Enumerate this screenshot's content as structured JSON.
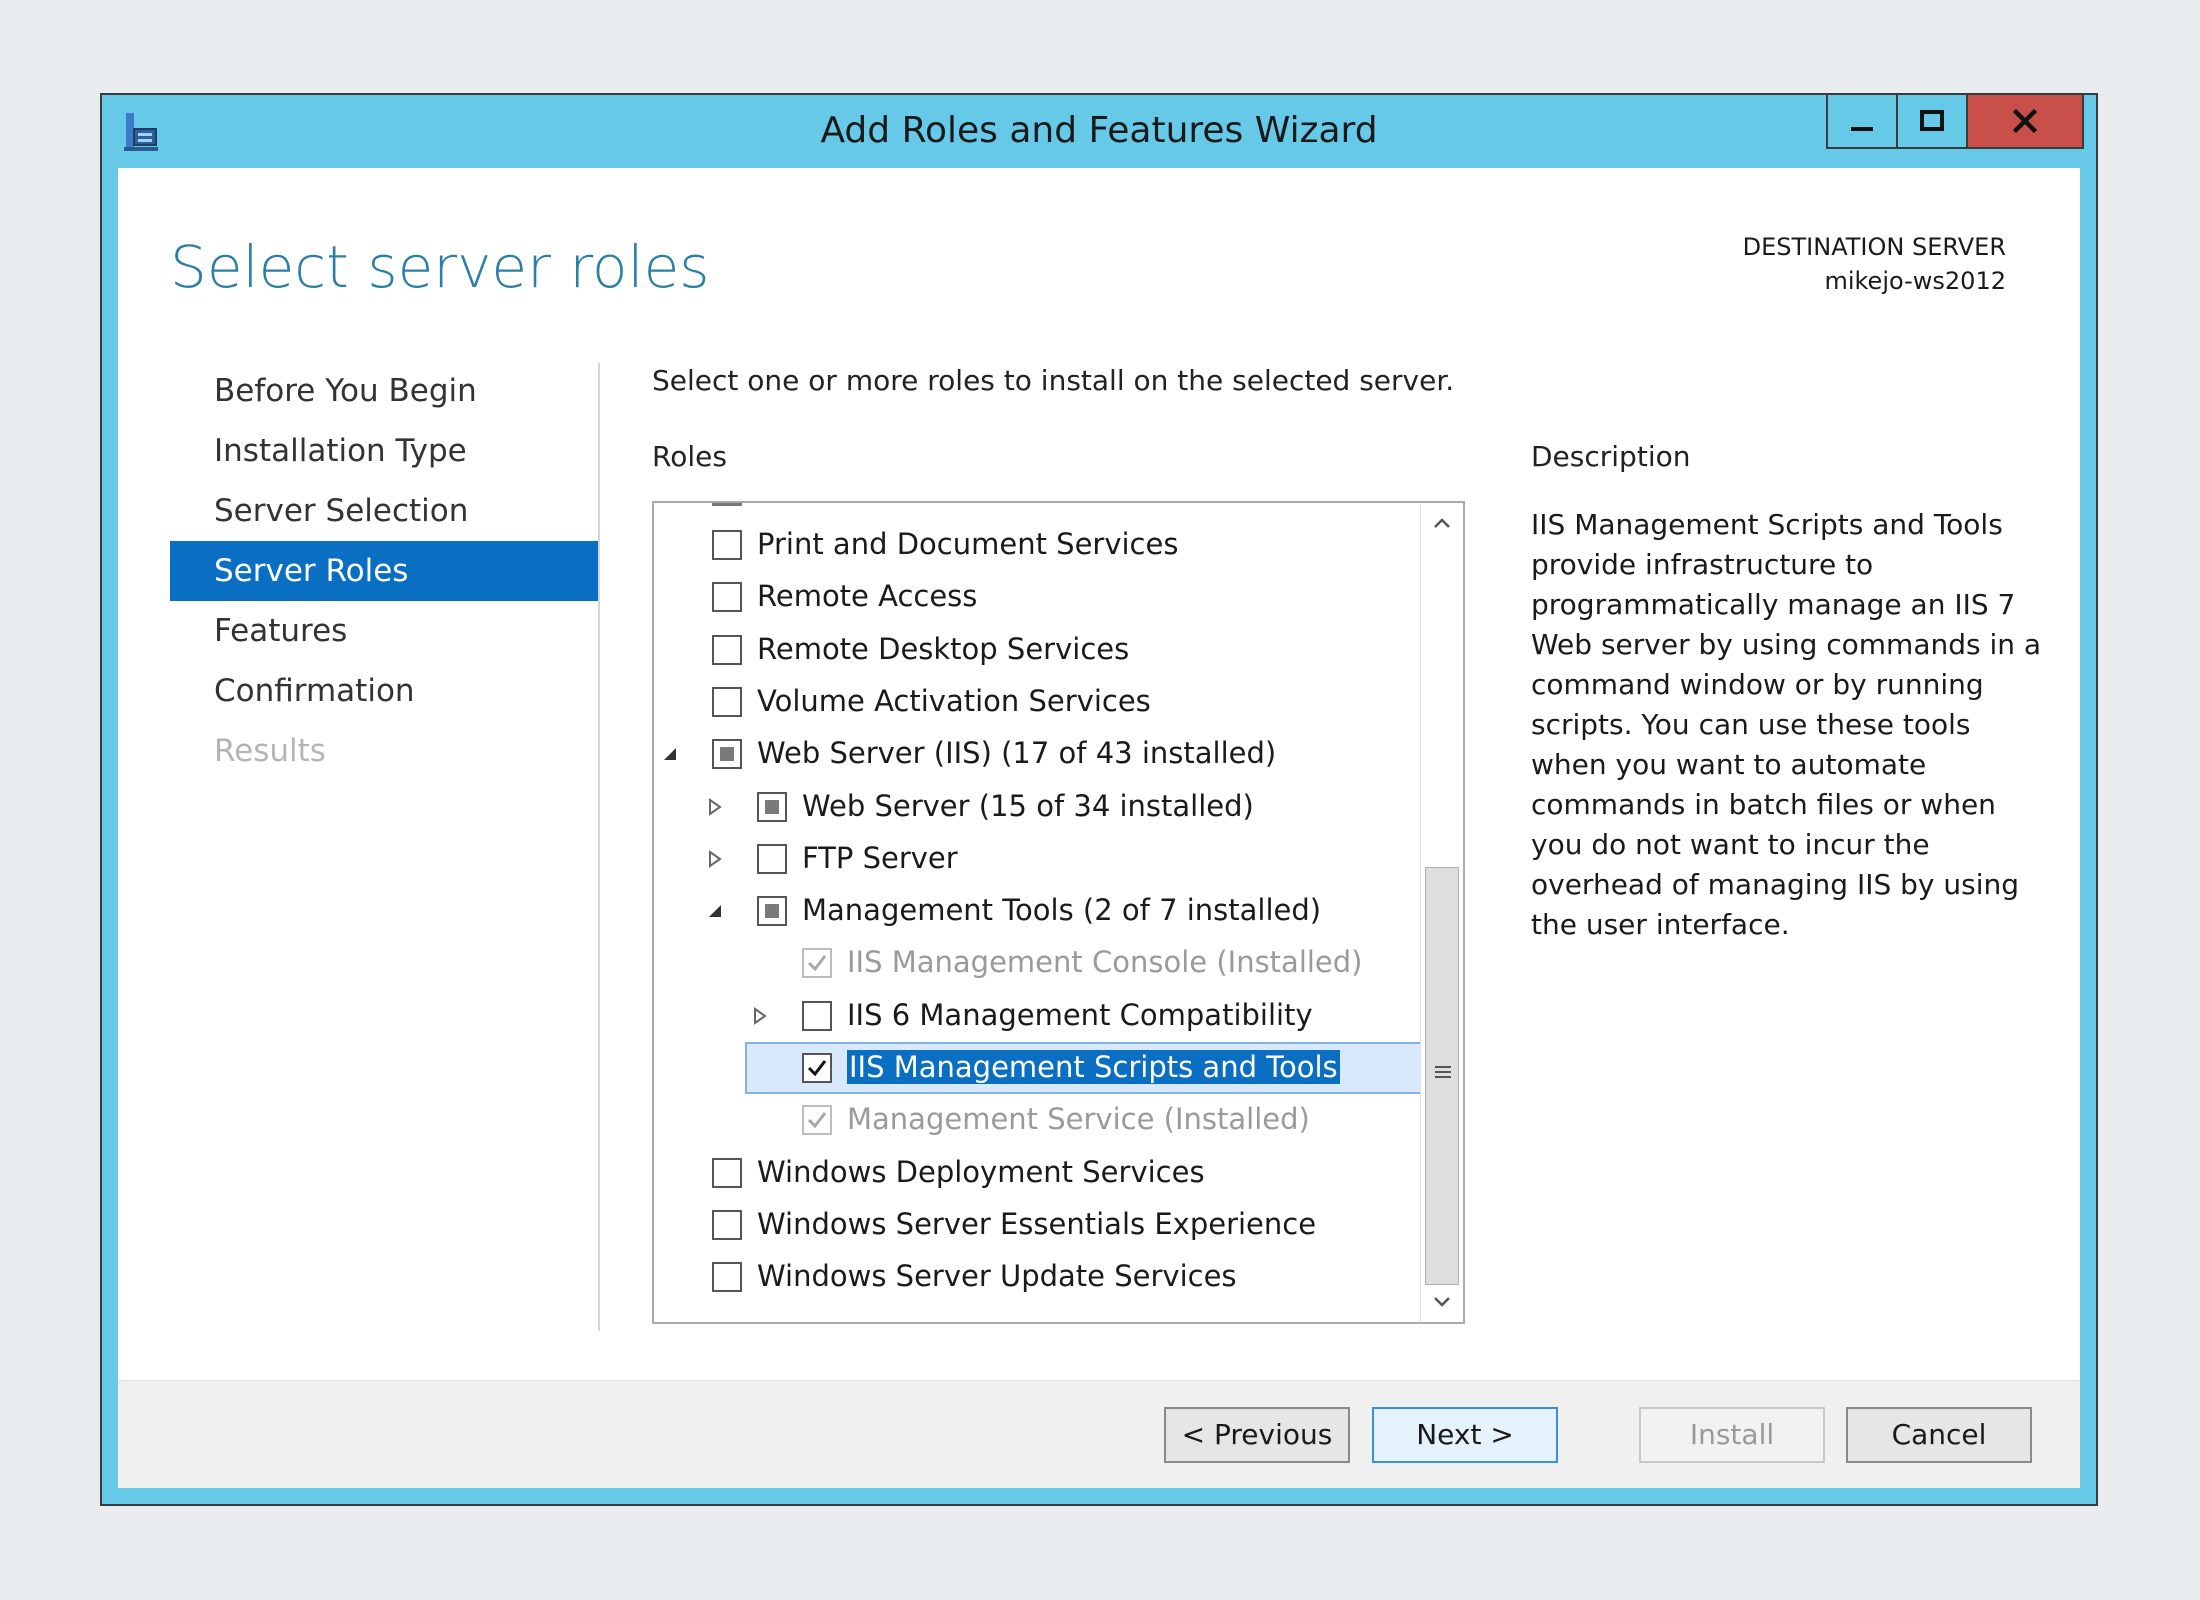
{
  "window": {
    "title": "Add Roles and Features Wizard"
  },
  "page": {
    "title": "Select server roles",
    "destination_label": "DESTINATION SERVER",
    "destination_server": "mikejo-ws2012",
    "instruction": "Select one or more roles to install on the selected server."
  },
  "nav": {
    "items": [
      {
        "label": "Before You Begin",
        "state": "normal"
      },
      {
        "label": "Installation Type",
        "state": "normal"
      },
      {
        "label": "Server Selection",
        "state": "normal"
      },
      {
        "label": "Server Roles",
        "state": "active"
      },
      {
        "label": "Features",
        "state": "normal"
      },
      {
        "label": "Confirmation",
        "state": "normal"
      },
      {
        "label": "Results",
        "state": "disabled"
      }
    ]
  },
  "roles": {
    "header": "Roles",
    "items": [
      {
        "label": "Print and Document Services",
        "level": 0,
        "checkbox": "unchecked",
        "expander": "none"
      },
      {
        "label": "Remote Access",
        "level": 0,
        "checkbox": "unchecked",
        "expander": "none"
      },
      {
        "label": "Remote Desktop Services",
        "level": 0,
        "checkbox": "unchecked",
        "expander": "none"
      },
      {
        "label": "Volume Activation Services",
        "level": 0,
        "checkbox": "unchecked",
        "expander": "none"
      },
      {
        "label": "Web Server (IIS) (17 of 43 installed)",
        "level": 0,
        "checkbox": "partial",
        "expander": "expanded"
      },
      {
        "label": "Web Server (15 of 34 installed)",
        "level": 1,
        "checkbox": "partial",
        "expander": "collapsed"
      },
      {
        "label": "FTP Server",
        "level": 1,
        "checkbox": "unchecked",
        "expander": "collapsed"
      },
      {
        "label": "Management Tools (2 of 7 installed)",
        "level": 1,
        "checkbox": "partial",
        "expander": "expanded"
      },
      {
        "label": "IIS Management Console (Installed)",
        "level": 2,
        "checkbox": "checked-dim",
        "expander": "none"
      },
      {
        "label": "IIS 6 Management Compatibility",
        "level": 2,
        "checkbox": "unchecked",
        "expander": "collapsed"
      },
      {
        "label": "IIS Management Scripts and Tools",
        "level": 2,
        "checkbox": "checked",
        "expander": "none",
        "selected": true
      },
      {
        "label": "Management Service (Installed)",
        "level": 2,
        "checkbox": "checked-dim",
        "expander": "none"
      },
      {
        "label": "Windows Deployment Services",
        "level": 0,
        "checkbox": "unchecked",
        "expander": "none"
      },
      {
        "label": "Windows Server Essentials Experience",
        "level": 0,
        "checkbox": "unchecked",
        "expander": "none"
      },
      {
        "label": "Windows Server Update Services",
        "level": 0,
        "checkbox": "unchecked",
        "expander": "none"
      }
    ]
  },
  "description": {
    "header": "Description",
    "text": "IIS Management Scripts and Tools provide infrastructure to programmatically manage an IIS 7 Web server by using commands in a command window or by running scripts. You can use these tools when you want to automate commands in batch files or when you do not want to incur the overhead of managing IIS by using the user interface."
  },
  "buttons": {
    "previous": "< Previous",
    "next": "Next >",
    "install": "Install",
    "cancel": "Cancel"
  },
  "icons": {
    "app": "server-manager-icon",
    "minimize": "minimize-icon",
    "maximize": "maximize-icon",
    "close": "close-icon",
    "scroll_up": "chevron-up-icon",
    "scroll_down": "chevron-down-icon",
    "scroll_grip": "grip-icon"
  },
  "colors": {
    "titlebar": "#67c9e8",
    "accent": "#0a6fc2",
    "close": "#c9504a",
    "title_text": "#2b7fa6"
  }
}
